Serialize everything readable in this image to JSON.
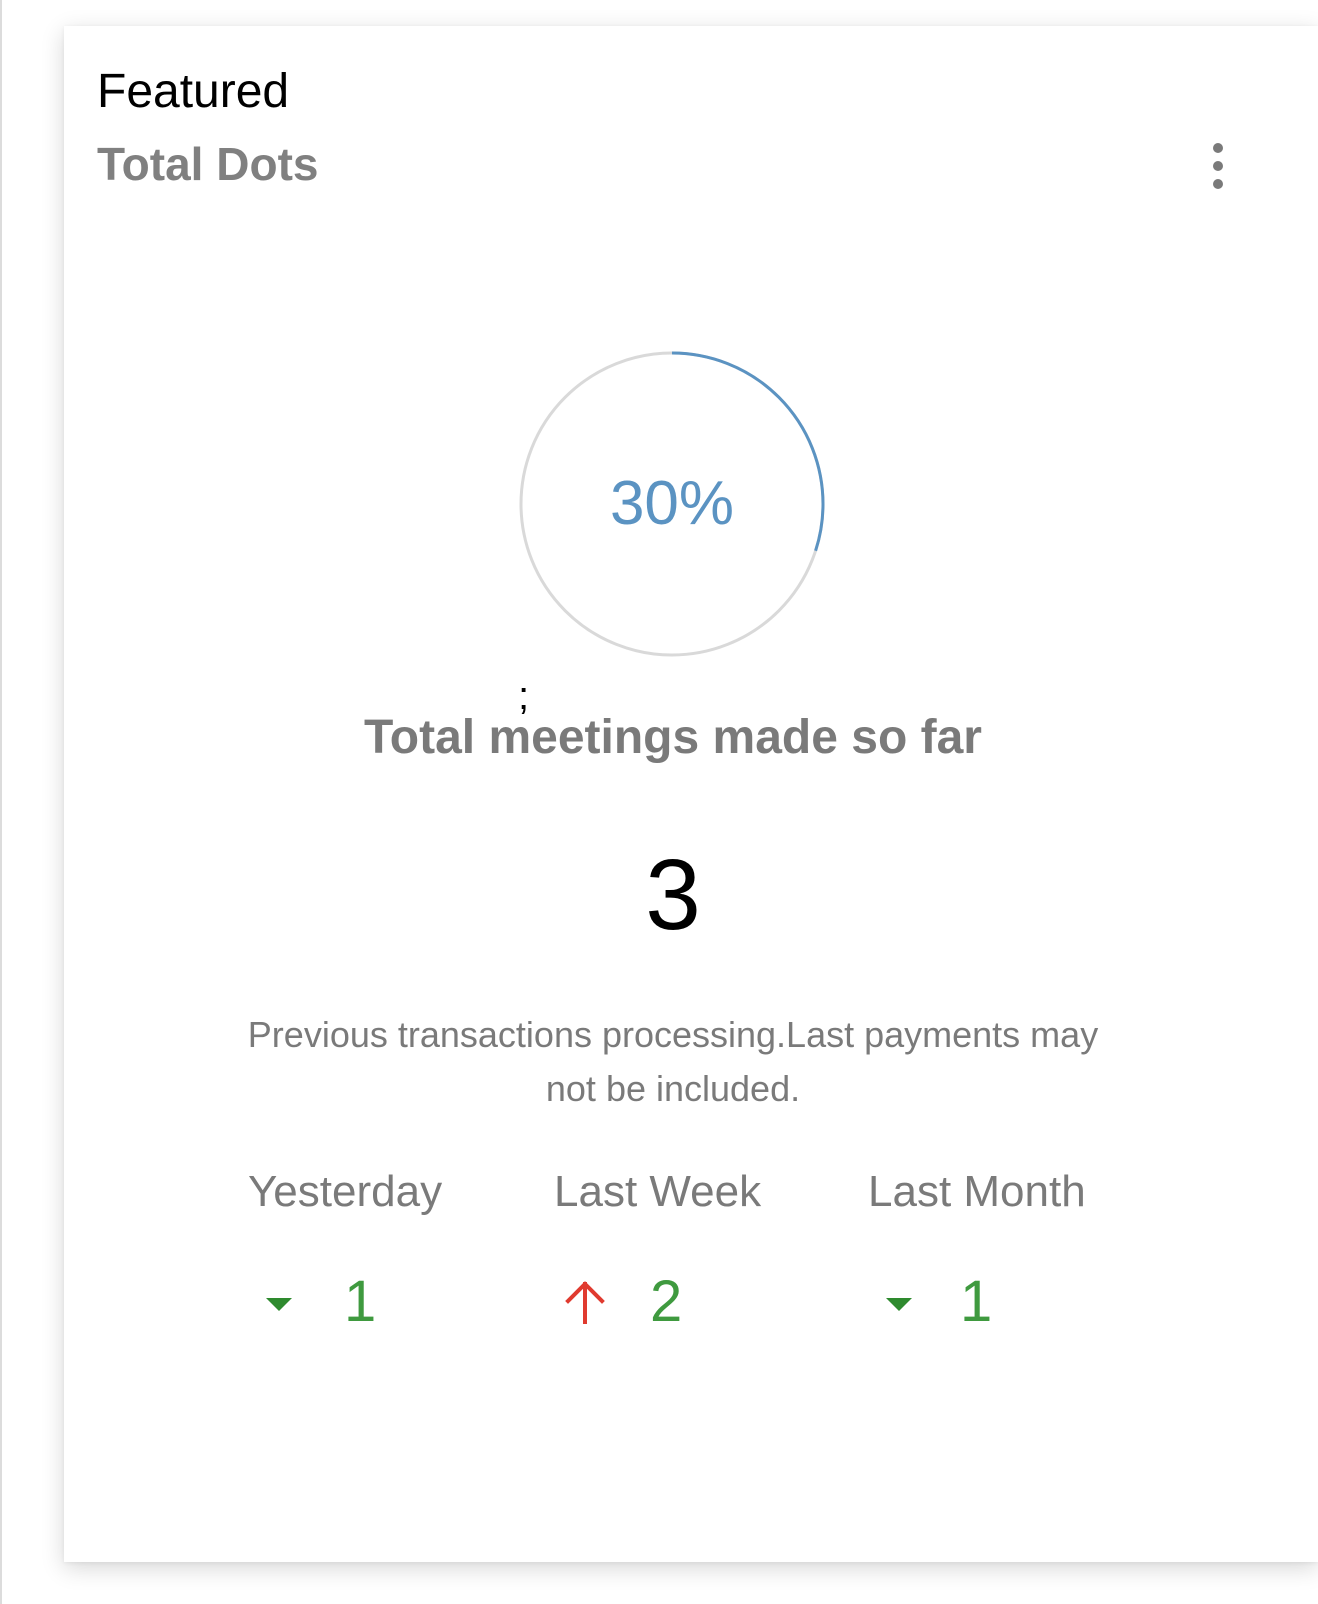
{
  "card": {
    "title": "Featured",
    "subtitle": "Total Dots",
    "menu_icon": "more-vertical-icon"
  },
  "progress": {
    "percent_label": "30%",
    "value": 0.3,
    "track_color": "#d9d9d9",
    "fill_color": "#5b93c2"
  },
  "stray_mark": ";",
  "summary": {
    "caption": "Total meetings made so far",
    "total": "3",
    "note": "Previous transactions processing.Last payments may not be included."
  },
  "stats": [
    {
      "label": "Yesterday",
      "value": "1",
      "trend": "down",
      "icon": "caret-down-icon",
      "icon_color": "#2e8a2e"
    },
    {
      "label": "Last Week",
      "value": "2",
      "trend": "up",
      "icon": "arrow-up-icon",
      "icon_color": "#e03a2f"
    },
    {
      "label": "Last Month",
      "value": "1",
      "trend": "down",
      "icon": "caret-down-icon",
      "icon_color": "#2e8a2e"
    }
  ],
  "colors": {
    "positive": "#3f9a3f",
    "muted_text": "#7a7a7a",
    "accent": "#5b93c2"
  }
}
